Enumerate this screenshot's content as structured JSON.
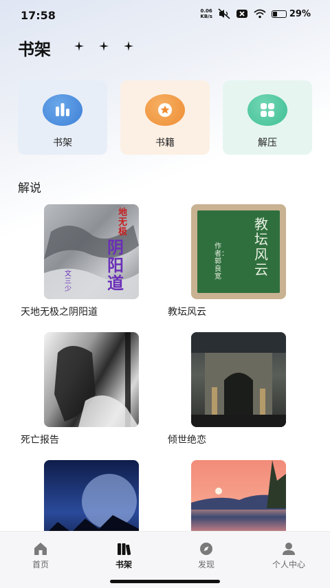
{
  "status_bar": {
    "time": "17:58",
    "net_speed_value": "0.06",
    "net_speed_unit": "KB/s",
    "battery_pct": "29%",
    "battery_level": 0.29
  },
  "header": {
    "title": "书架"
  },
  "categories": [
    {
      "label": "书架",
      "icon": "bar-chart-icon",
      "color": "#4a8fe0"
    },
    {
      "label": "书籍",
      "icon": "star-icon",
      "color": "#f09a3e"
    },
    {
      "label": "解压",
      "icon": "grid-icon",
      "color": "#4fc9a0"
    }
  ],
  "section": {
    "title": "解说"
  },
  "books": [
    {
      "title": "天地无极之阴阳道",
      "cover_text": {
        "top": "地无极",
        "main": "阴阳道",
        "side": "文三少"
      }
    },
    {
      "title": "教坛风云",
      "cover_text": {
        "main": "教坛风云",
        "side": "作者：郭良宽"
      }
    },
    {
      "title": "死亡报告"
    },
    {
      "title": "倾世绝恋"
    },
    {
      "title": ""
    },
    {
      "title": ""
    }
  ],
  "tabbar": {
    "items": [
      {
        "label": "首页",
        "icon": "home-icon"
      },
      {
        "label": "书架",
        "icon": "books-icon",
        "active": true
      },
      {
        "label": "发现",
        "icon": "compass-icon"
      },
      {
        "label": "个人中心",
        "icon": "person-icon"
      }
    ]
  }
}
